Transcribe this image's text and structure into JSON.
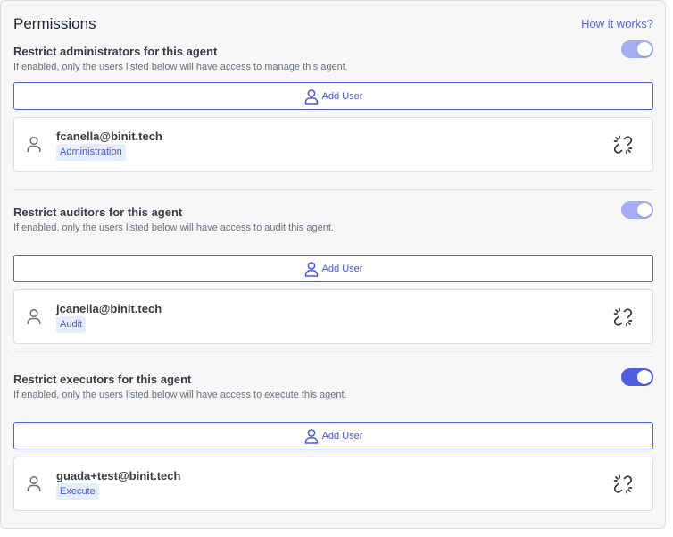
{
  "header": {
    "title": "Permissions",
    "help_link": "How it works?"
  },
  "colors": {
    "accent": "#4d5ee0",
    "toggle_light": "#a4acf4",
    "badge_bg": "#e5edff"
  },
  "sections": [
    {
      "title": "Restrict administrators for this agent",
      "description": "If enabled, only the users listed below will have access to manage this agent.",
      "toggle_state": "on-light",
      "add_button_label": "Add User",
      "user": {
        "email": "fcanella@binit.tech",
        "role": "Administration"
      }
    },
    {
      "title": "Restrict auditors for this agent",
      "description": "If enabled, only the users listed below will have access to audit this agent.",
      "toggle_state": "on-light",
      "add_button_label": "Add User",
      "user": {
        "email": "jcanella@binit.tech",
        "role": "Audit"
      }
    },
    {
      "title": "Restrict executors for this agent",
      "description": "If enabled, only the users listed below will have access to execute this agent.",
      "toggle_state": "on",
      "add_button_label": "Add User",
      "user": {
        "email": "guada+test@binit.tech",
        "role": "Execute"
      }
    }
  ],
  "icons": {
    "add_user": "user-icon",
    "avatar": "user-icon",
    "remove": "unlink-icon"
  }
}
